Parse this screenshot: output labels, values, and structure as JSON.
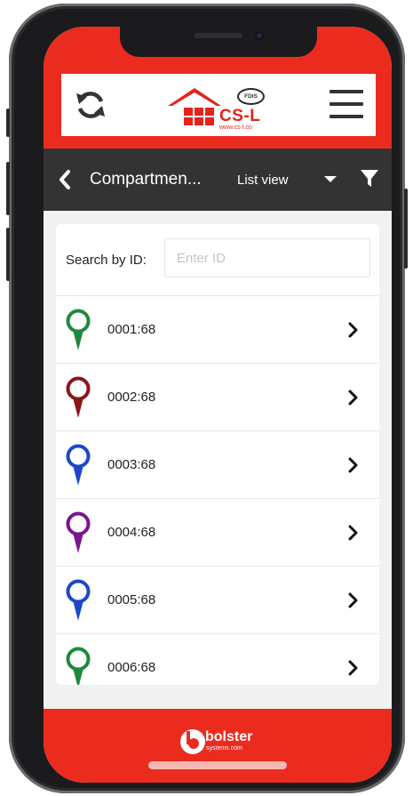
{
  "header": {
    "logo_text": "CS-L",
    "logo_url": "www.cs-l.co",
    "logo_badge": "FDIS",
    "refresh_icon": "refresh-icon",
    "menu_icon": "hamburger-menu-icon",
    "accent": "#ec2b1f"
  },
  "nav": {
    "title": "Compartmen...",
    "view_label": "List view",
    "bar_color": "#333333"
  },
  "search": {
    "label": "Search by ID:",
    "placeholder": "Enter ID",
    "value": ""
  },
  "items": [
    {
      "label": "0001:68",
      "color": "#1d8a3a"
    },
    {
      "label": "0002:68",
      "color": "#8b1519"
    },
    {
      "label": "0003:68",
      "color": "#1c48c8"
    },
    {
      "label": "0004:68",
      "color": "#7c1490"
    },
    {
      "label": "0005:68",
      "color": "#1c48c8"
    },
    {
      "label": "0006:68",
      "color": "#1d8a3a"
    }
  ],
  "footer": {
    "brand": "bolster",
    "brand_sub": "systems.com"
  }
}
